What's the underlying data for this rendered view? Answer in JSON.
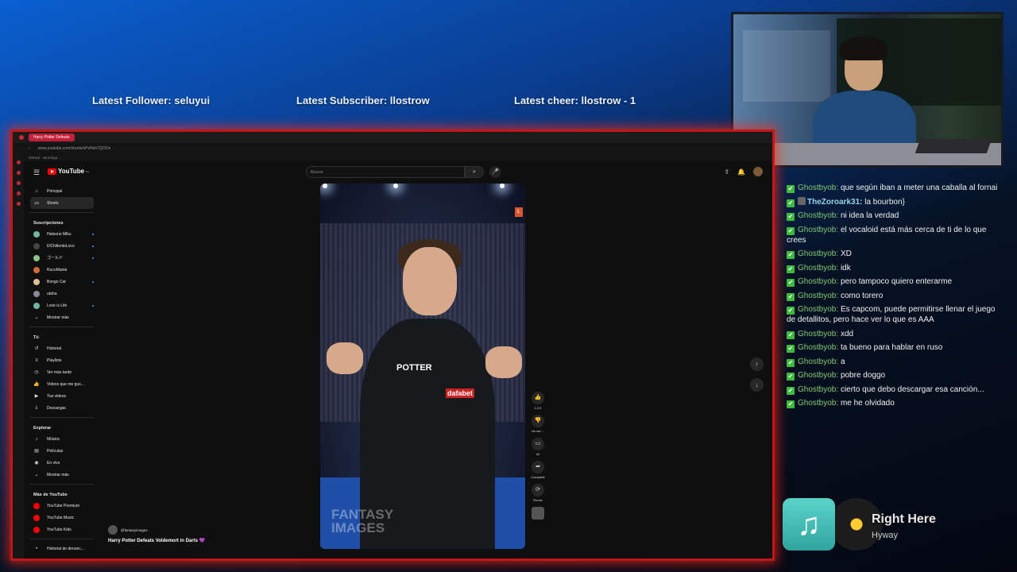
{
  "overlay": {
    "latest_follower": "Latest Follower: seluyui",
    "latest_subscriber": "Latest Subscriber: llostrow",
    "latest_cheer": "Latest cheer: llostrow - 1"
  },
  "browser": {
    "tab_title": "Harry Potter Defeats",
    "url": "www.youtube.com/shorts/sPsHeh7QOOs",
    "bookmark": "GitHub - wiredopp..."
  },
  "youtube": {
    "logo_text": "YouTube",
    "logo_region": "ES",
    "search_placeholder": "Buscar",
    "sidebar": {
      "main": [
        {
          "label": "Principal",
          "icon": "home-icon"
        },
        {
          "label": "Shorts",
          "icon": "shorts-icon"
        }
      ],
      "subs_header": "Suscripciones",
      "subs": [
        {
          "label": "Hatsune Miku",
          "color": "#6fb7a9"
        },
        {
          "label": "ElChilientoLoco",
          "color": "#444444"
        },
        {
          "label": "ゴールド",
          "color": "#8bc38b"
        },
        {
          "label": "RucoMania",
          "color": "#d26b3a"
        },
        {
          "label": "Bongo Cat",
          "color": "#e0c090"
        },
        {
          "label": "utaha",
          "color": "#888899"
        },
        {
          "label": "Love is Life",
          "color": "#6fb7a9"
        }
      ],
      "show_more": "Mostrar más",
      "you_header": "Tú",
      "you": [
        {
          "label": "Historial",
          "icon": "history-icon"
        },
        {
          "label": "Playlists",
          "icon": "playlist-icon"
        },
        {
          "label": "Ver más tarde",
          "icon": "clock-icon"
        },
        {
          "label": "Videos que me gus...",
          "icon": "like-icon"
        },
        {
          "label": "Tus videos",
          "icon": "video-icon"
        },
        {
          "label": "Descargas",
          "icon": "download-icon"
        }
      ],
      "explore_header": "Explorar",
      "explore": [
        {
          "label": "Música",
          "icon": "music-icon"
        },
        {
          "label": "Películas",
          "icon": "film-icon"
        },
        {
          "label": "En vivo",
          "icon": "live-icon"
        },
        {
          "label": "Mostrar más",
          "icon": "chevron-down-icon"
        }
      ],
      "more_header": "Más de YouTube",
      "more": [
        {
          "label": "YouTube Premium",
          "color": "#ff0000"
        },
        {
          "label": "YouTube Music",
          "color": "#ff0000"
        },
        {
          "label": "YouTube Kids",
          "color": "#ff0000"
        }
      ],
      "report": "Historial de denunc..."
    },
    "short": {
      "watermark": "FANTASY IMAGES",
      "jersey": "POTTER",
      "sponsor": "dafabet",
      "badge": "L"
    },
    "actions": {
      "likes": "1.3 K",
      "dislike": "No me ...",
      "comments": "42",
      "share": "Compartir",
      "remix": "Remix"
    },
    "channel": "@fantasyimages",
    "title": "Harry Potter Defeats Voldemort in Darts 💜"
  },
  "chat": [
    {
      "user": "Ghostbyob",
      "text": "que según iban a meter una caballa al fornai"
    },
    {
      "user": "TheZoroark31",
      "text": "la bourbon}",
      "alt": true
    },
    {
      "user": "Ghostbyob",
      "text": "ni idea la verdad"
    },
    {
      "user": "Ghostbyob",
      "text": "el vocaloid está más cerca de ti de lo que crees"
    },
    {
      "user": "Ghostbyob",
      "text": "XD"
    },
    {
      "user": "Ghostbyob",
      "text": "idk"
    },
    {
      "user": "Ghostbyob",
      "text": "pero tampoco quiero enterarme"
    },
    {
      "user": "Ghostbyob",
      "text": "como torero"
    },
    {
      "user": "Ghostbyob",
      "text": "Es capcom, puede permitirse llenar el juego de detallitos, pero hace ver lo que es AAA"
    },
    {
      "user": "Ghostbyob",
      "text": "xdd"
    },
    {
      "user": "Ghostbyob",
      "text": "ta bueno para hablar en ruso"
    },
    {
      "user": "Ghostbyob",
      "text": "a"
    },
    {
      "user": "Ghostbyob",
      "text": "pobre doggo"
    },
    {
      "user": "Ghostbyob",
      "text": "cierto que debo descargar esa canción..."
    },
    {
      "user": "Ghostbyob",
      "text": "me he olvidado"
    }
  ],
  "now_playing": {
    "title": "Right Here",
    "artist": "Hyway"
  }
}
